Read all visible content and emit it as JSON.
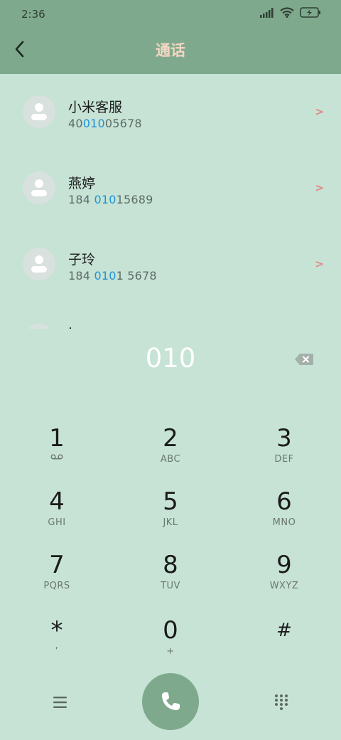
{
  "status": {
    "time": "2:36"
  },
  "header": {
    "title": "通话"
  },
  "contacts": [
    {
      "name": "小米客服",
      "num_pre": "40",
      "num_hl": "010",
      "num_post": "05678"
    },
    {
      "name": "燕婷",
      "num_pre": "184 ",
      "num_hl": "010",
      "num_post": "15689"
    },
    {
      "name": "子玲",
      "num_pre": "184 ",
      "num_hl": "010",
      "num_post": "1 5678"
    }
  ],
  "partial_contact_name": "·",
  "dial_display": "010",
  "keys": [
    {
      "digit": "1",
      "letters": ""
    },
    {
      "digit": "2",
      "letters": "ABC"
    },
    {
      "digit": "3",
      "letters": "DEF"
    },
    {
      "digit": "4",
      "letters": "GHI"
    },
    {
      "digit": "5",
      "letters": "JKL"
    },
    {
      "digit": "6",
      "letters": "MNO"
    },
    {
      "digit": "7",
      "letters": "PQRS"
    },
    {
      "digit": "8",
      "letters": "TUV"
    },
    {
      "digit": "9",
      "letters": "WXYZ"
    },
    {
      "digit": "*",
      "letters": ","
    },
    {
      "digit": "0",
      "letters": "+"
    },
    {
      "digit": "#",
      "letters": ""
    }
  ],
  "colors": {
    "background": "#c6e3d6",
    "header": "#7fa98c",
    "title": "#f5d7c4",
    "highlight": "#1e94d6",
    "chevron": "#e58585"
  },
  "icons": {
    "back": "back-arrow-icon",
    "backspace": "backspace-icon",
    "menu": "hamburger-menu-icon",
    "call": "phone-icon",
    "dialpad": "dialpad-grid-icon",
    "voicemail": "voicemail-icon"
  }
}
